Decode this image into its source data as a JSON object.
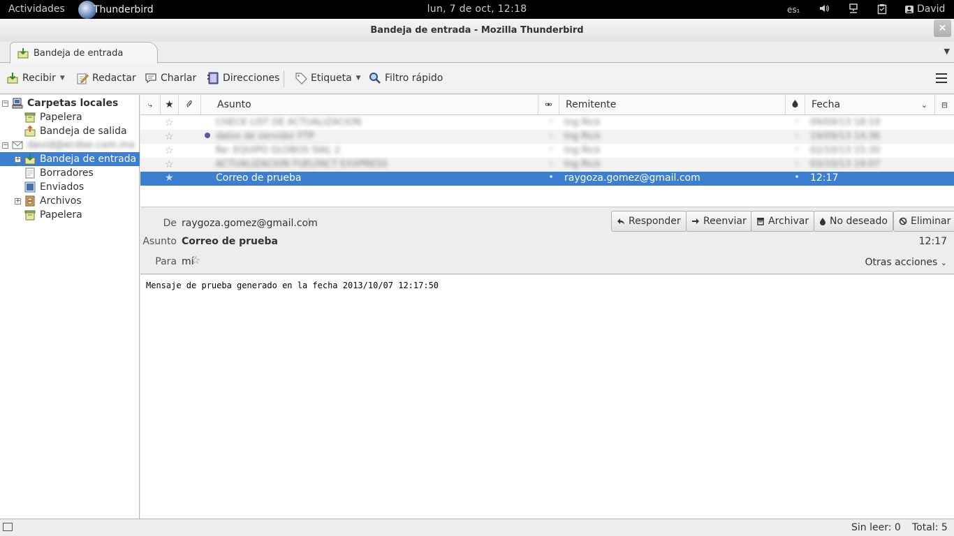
{
  "topbar": {
    "activities": "Actividades",
    "app_name": "Thunderbird",
    "clock": "lun,  7 de oct, 12:18",
    "keyboard": "es₁",
    "user": "David"
  },
  "window": {
    "title": "Bandeja de entrada - Mozilla Thunderbird",
    "close": "×"
  },
  "tabs": [
    {
      "label": "Bandeja de entrada"
    }
  ],
  "toolbar": {
    "recibir": "Recibir",
    "redactar": "Redactar",
    "charlar": "Charlar",
    "direcciones": "Direcciones",
    "etiqueta": "Etiqueta",
    "filtro": "Filtro rápido"
  },
  "folders": {
    "local_root": "Carpetas locales",
    "local_items": [
      "Papelera",
      "Bandeja de salida"
    ],
    "account_name": "david@ecdse.com.mx",
    "account_items": [
      "Bandeja de entrada",
      "Borradores",
      "Enviados",
      "Archivos",
      "Papelera"
    ]
  },
  "columns": {
    "subject": "Asunto",
    "sender": "Remitente",
    "date": "Fecha"
  },
  "messages": [
    {
      "subject": "CHECK LIST DE ACTUALIZACION",
      "sender": "Ing Rick",
      "date": "09/09/13 18:19",
      "blurred": true
    },
    {
      "subject": "datos de servidor FTP",
      "sender": "Ing Rick",
      "date": "19/09/13 14:36",
      "blurred": true
    },
    {
      "subject": "Re: EQUIPO GLOBOS SIAL 2",
      "sender": "Ing Rick",
      "date": "02/10/13 15:30",
      "blurred": true
    },
    {
      "subject": "ACTUALIZACION FUELFACT EXXPRESS",
      "sender": "Ing Rick",
      "date": "03/10/13 19:07",
      "blurred": true
    },
    {
      "subject": "Correo de prueba",
      "sender": "raygoza.gomez@gmail.com",
      "date": "12:17",
      "selected": true
    }
  ],
  "header": {
    "from_label": "De",
    "from": "raygoza.gomez@gmail.com",
    "subject_label": "Asunto",
    "subject": "Correo de prueba",
    "to_label": "Para",
    "to": "mí",
    "time": "12:17",
    "otras": "Otras acciones",
    "responder": "Responder",
    "reenviar": "Reenviar",
    "archivar": "Archivar",
    "no_deseado": "No deseado",
    "eliminar": "Eliminar"
  },
  "body": {
    "text": "Mensaje de prueba generado en la fecha 2013/10/07 12:17:50"
  },
  "status": {
    "unread": "Sin leer: 0",
    "total": "Total: 5"
  },
  "colors": {
    "selection": "#3c7ecf",
    "topbar": "#000000"
  }
}
